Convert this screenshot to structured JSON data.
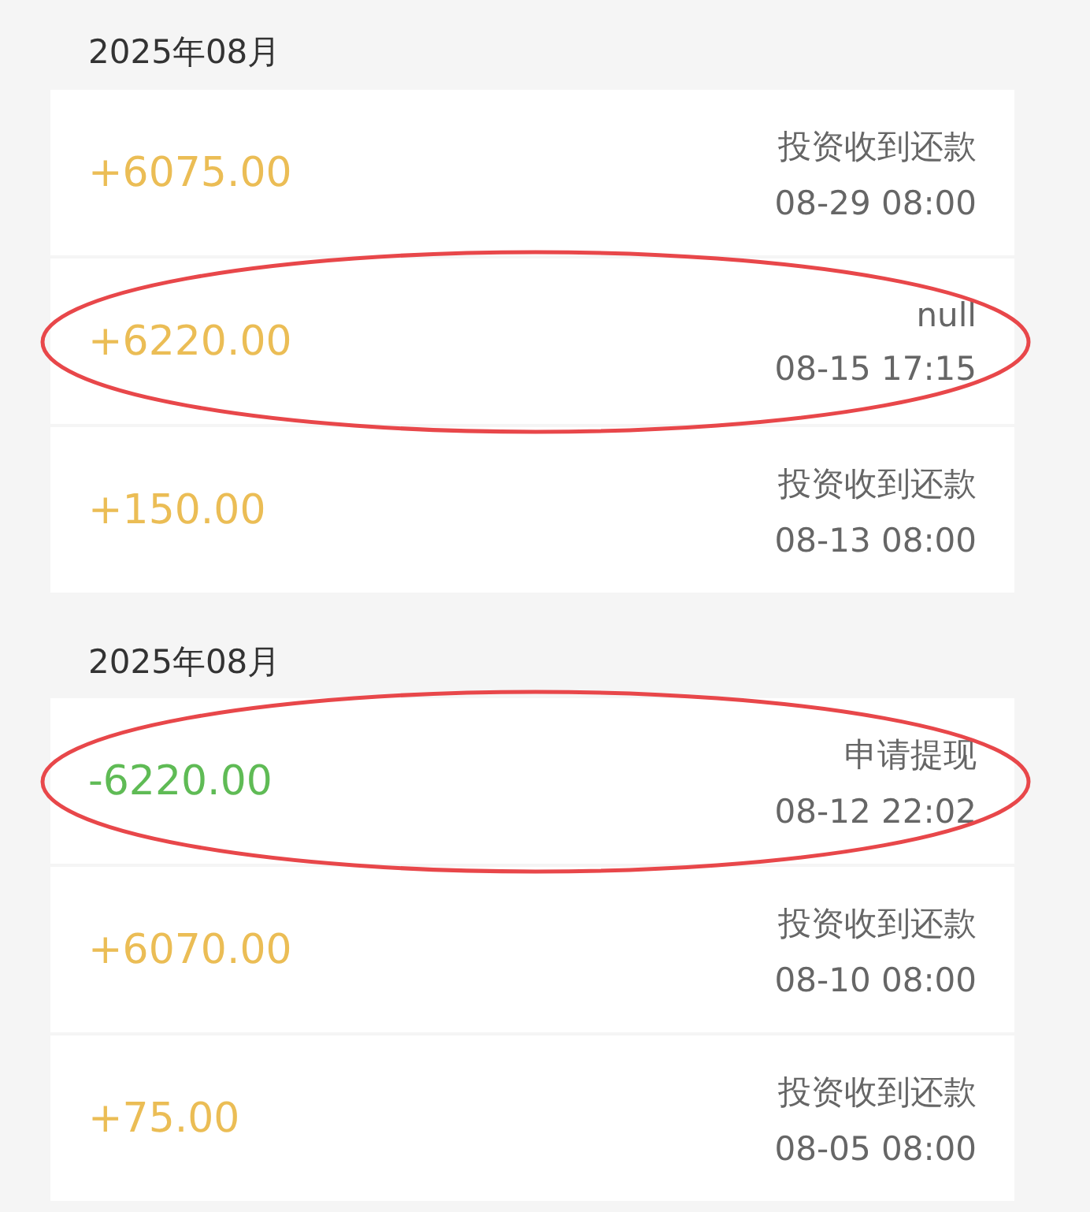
{
  "sections": [
    {
      "header": "2025年08月",
      "transactions": [
        {
          "amount": "+6075.00",
          "kind": "income",
          "description": "投资收到还款",
          "time": "08-29 08:00",
          "circled": false
        },
        {
          "amount": "+6220.00",
          "kind": "income",
          "description": "null",
          "time": "08-15 17:15",
          "circled": true
        },
        {
          "amount": "+150.00",
          "kind": "income",
          "description": "投资收到还款",
          "time": "08-13 08:00",
          "circled": false
        }
      ]
    },
    {
      "header": "2025年08月",
      "transactions": [
        {
          "amount": "-6220.00",
          "kind": "expense",
          "description": "申请提现",
          "time": "08-12 22:02",
          "circled": true
        },
        {
          "amount": "+6070.00",
          "kind": "income",
          "description": "投资收到还款",
          "time": "08-10 08:00",
          "circled": false
        },
        {
          "amount": "+75.00",
          "kind": "income",
          "description": "投资收到还款",
          "time": "08-05 08:00",
          "circled": false
        }
      ]
    }
  ]
}
